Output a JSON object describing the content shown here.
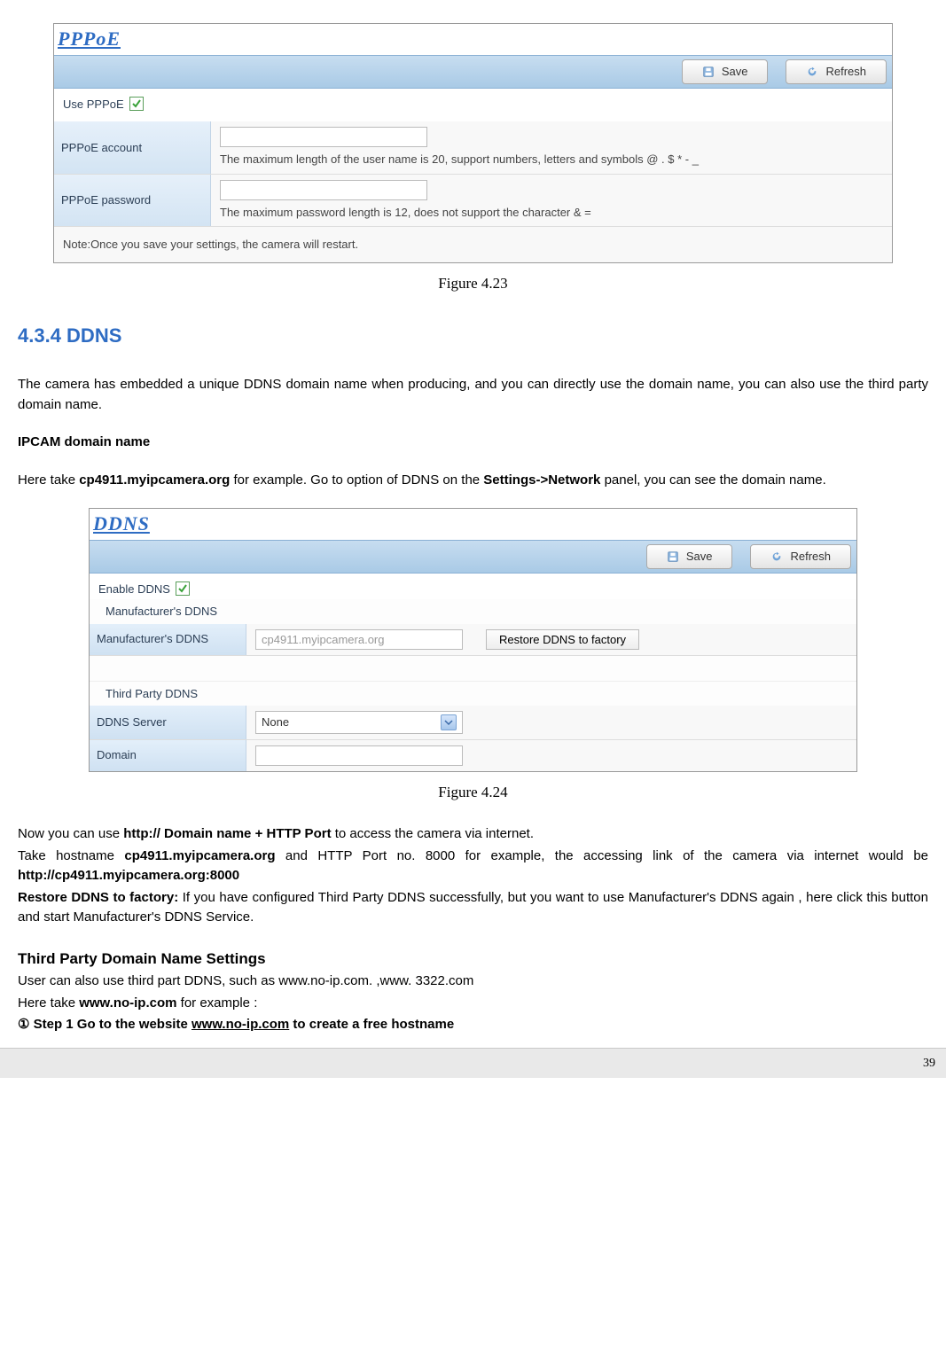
{
  "fig1": {
    "title": "PPPoE",
    "save": "Save",
    "refresh": "Refresh",
    "use_pppoe": "Use PPPoE",
    "account_label": "PPPoE account",
    "account_hint": "The maximum length of the user name is 20, support numbers, letters and symbols @ . $ * - _",
    "password_label": "PPPoE password",
    "password_hint": "The maximum password length is 12, does not support the character & =",
    "note": "Note:Once you save your settings, the camera will restart.",
    "caption": "Figure 4.23"
  },
  "section_heading": "4.3.4 DDNS",
  "para1": "The camera has embedded a unique DDNS domain name when producing, and you can directly use the domain name, you can also use the third party domain name.",
  "ipcam_head": "IPCAM domain name",
  "para2_a": "Here take ",
  "para2_b": "cp4911.myipcamera.org",
  "para2_c": " for example. Go to option of DDNS on the ",
  "para2_d": "Settings->Network",
  "para2_e": " panel, you can see the domain name.",
  "fig2": {
    "title": "DDNS",
    "save": "Save",
    "refresh": "Refresh",
    "enable": "Enable DDNS",
    "mfr_header": "Manufacturer's DDNS",
    "mfr_label": "Manufacturer's DDNS",
    "mfr_value": "cp4911.myipcamera.org",
    "restore": "Restore DDNS to factory",
    "third_header": "Third Party DDNS",
    "server_label": "DDNS Server",
    "server_value": "None",
    "domain_label": "Domain",
    "caption": "Figure 4.24"
  },
  "para3_a": "Now you can use ",
  "para3_b": "http:// Domain name + HTTP Port",
  "para3_c": " to access the camera via internet.",
  "para4_a": "Take hostname ",
  "para4_b": "cp4911.myipcamera.org",
  "para4_c": " and HTTP Port no. 8000 for example, the accessing link of the camera via internet would be ",
  "para4_d": "http://cp4911.myipcamera.org:8000",
  "para5_a": "Restore DDNS to factory:",
  "para5_b": " If you have configured Third Party DDNS successfully, but you want to use Manufacturer's DDNS again , here click this button and start Manufacturer's DDNS Service.",
  "third_head": "Third Party Domain Name Settings",
  "para6": "User can also use third part DDNS, such as www.no-ip.com. ,www. 3322.com",
  "para7_a": "Here take ",
  "para7_b": "www.no-ip.com",
  "para7_c": " for example :",
  "step1_a": "① Step 1 Go to the website ",
  "step1_b": "www.no-ip.com",
  "step1_c": " to create a free hostname",
  "page_no": "39"
}
